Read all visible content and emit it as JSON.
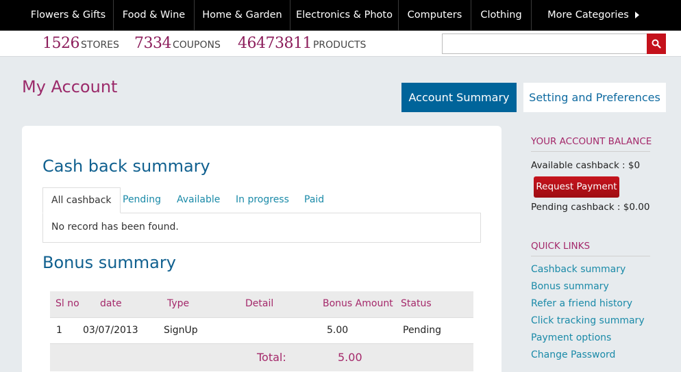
{
  "nav": {
    "categories": [
      "Flowers & Gifts",
      "Food & Wine",
      "Home & Garden",
      "Electronics & Photo",
      "Computers",
      "Clothing",
      "More Categories"
    ]
  },
  "stats": [
    {
      "number": "1526",
      "label": "STORES"
    },
    {
      "number": "7334",
      "label": "COUPONS"
    },
    {
      "number": "46473811",
      "label": "PRODUCTS"
    }
  ],
  "search": {
    "value": "",
    "placeholder": "",
    "icon": "search-icon"
  },
  "page": {
    "title": "My Account",
    "tabs": [
      "Account Summary",
      "Setting and Preferences"
    ],
    "active_tab": "Account Summary"
  },
  "cashback": {
    "title": "Cash back summary",
    "tabs": [
      "All cashback",
      "Pending",
      "Available",
      "In progress",
      "Paid"
    ],
    "active_tab": "All cashback",
    "empty_message": "No record has been found."
  },
  "bonus": {
    "title": "Bonus summary",
    "columns": [
      "Sl no",
      "date",
      "Type",
      "Detail",
      "Bonus Amount",
      "Status"
    ],
    "rows": [
      {
        "sl_no": "1",
        "date": "03/07/2013",
        "type": "SignUp",
        "detail": "",
        "amount": "5.00",
        "status": "Pending"
      }
    ],
    "total_label": "Total:",
    "total_value": "5.00"
  },
  "sidebar": {
    "balance_heading": "YOUR ACCOUNT BALANCE",
    "available": "Available cashback : $0",
    "request_button": "Request Payment",
    "pending": "Pending cashback : $0.00",
    "links_heading": "QUICK LINKS",
    "links": [
      "Cashback summary",
      "Bonus summary",
      "Refer a friend history",
      "Click tracking summary",
      "Payment options",
      "Change Password"
    ]
  },
  "colors": {
    "accent_magenta": "#9b2a6a",
    "primary_blue": "#00649a",
    "link_teal": "#1a8aa8",
    "button_red": "#c4111b"
  }
}
